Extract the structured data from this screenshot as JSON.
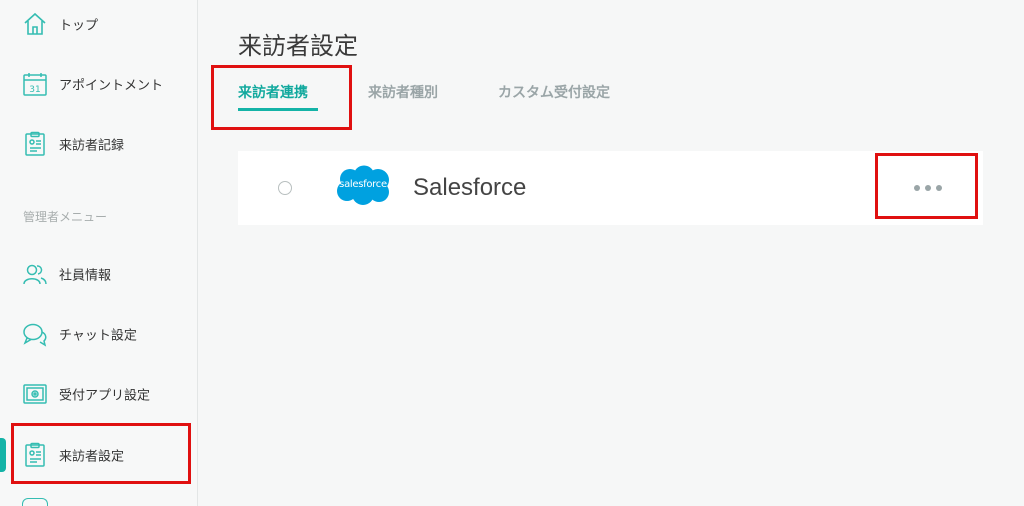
{
  "sidebar": {
    "items": [
      {
        "label": "トップ",
        "icon": "home-icon"
      },
      {
        "label": "アポイントメント",
        "icon": "calendar-icon"
      },
      {
        "label": "来訪者記録",
        "icon": "clipboard-icon"
      }
    ],
    "admin_section_label": "管理者メニュー",
    "admin_items": [
      {
        "label": "社員情報",
        "icon": "users-icon"
      },
      {
        "label": "チャット設定",
        "icon": "chat-icon"
      },
      {
        "label": "受付アプリ設定",
        "icon": "app-settings-icon"
      },
      {
        "label": "来訪者設定",
        "icon": "clipboard-icon"
      }
    ],
    "active_item": "来訪者設定"
  },
  "main": {
    "title": "来訪者設定",
    "tabs": [
      {
        "label": "来訪者連携",
        "active": true
      },
      {
        "label": "来訪者種別",
        "active": false
      },
      {
        "label": "カスタム受付設定",
        "active": false
      }
    ],
    "integration": {
      "logo_text": "salesforce",
      "name": "Salesforce",
      "more_icon": "more-horizontal-icon"
    }
  },
  "colors": {
    "accent": "#14b3a7",
    "annotation": "#e01010",
    "salesforce_blue": "#00a1e0"
  }
}
